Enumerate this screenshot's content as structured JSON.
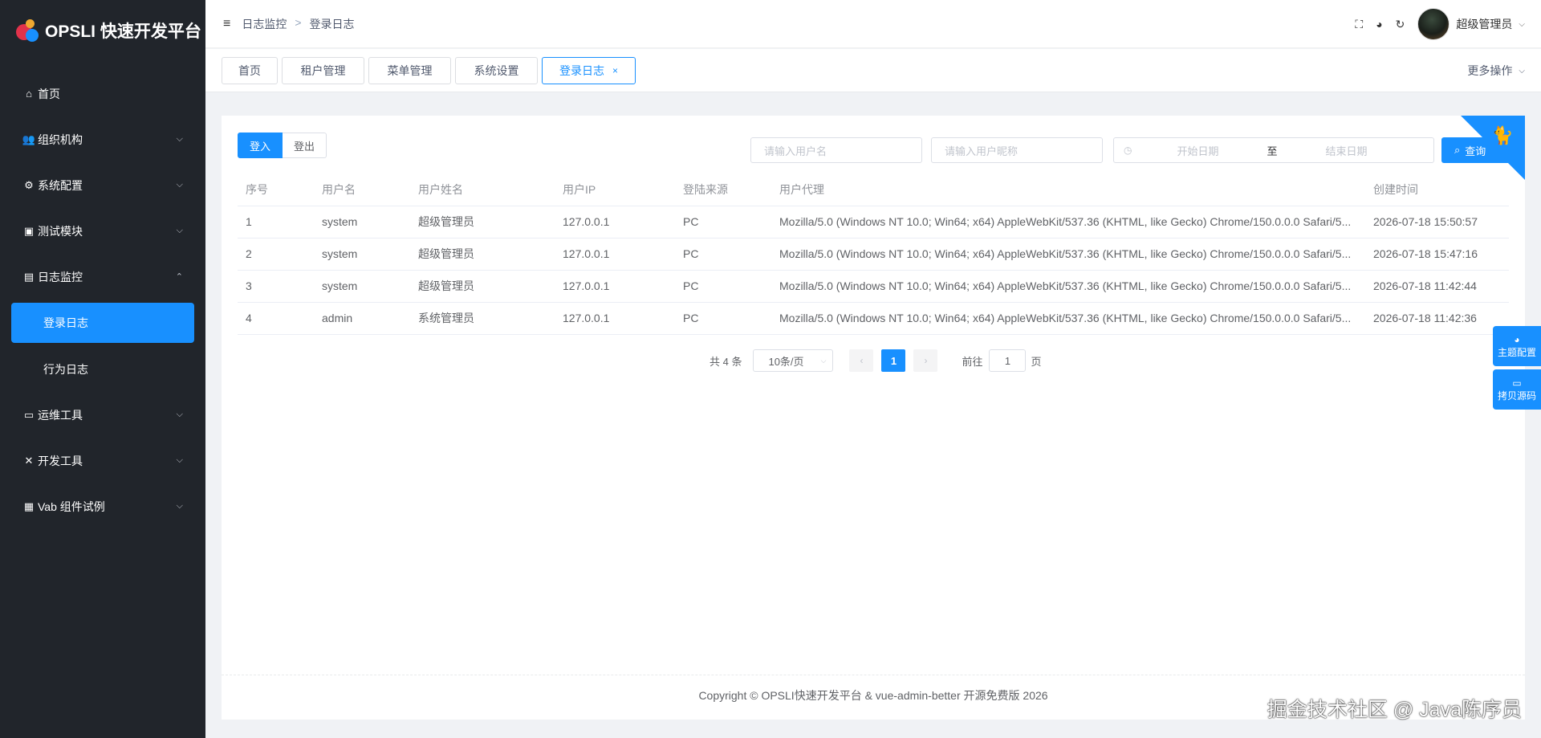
{
  "app": {
    "title": "OPSLI 快速开发平台"
  },
  "sidebar": {
    "items": [
      {
        "label": "首页",
        "icon": "home-icon",
        "glyph": "⌂"
      },
      {
        "label": "组织机构",
        "icon": "users-icon",
        "glyph": "👥"
      },
      {
        "label": "系统配置",
        "icon": "gear-icon",
        "glyph": "⚙"
      },
      {
        "label": "测试模块",
        "icon": "briefcase-icon",
        "glyph": "▣"
      },
      {
        "label": "日志监控",
        "icon": "file-icon",
        "glyph": "▤"
      },
      {
        "label": "运维工具",
        "icon": "monitor-icon",
        "glyph": "▭"
      },
      {
        "label": "开发工具",
        "icon": "tools-icon",
        "glyph": "✕"
      },
      {
        "label": "Vab 组件试例",
        "icon": "box-icon",
        "glyph": "▦"
      }
    ],
    "sub": {
      "login_log": "登录日志",
      "action_log": "行为日志"
    }
  },
  "navbar": {
    "breadcrumb": [
      "日志监控",
      "登录日志"
    ],
    "username": "超级管理员"
  },
  "tabs": [
    {
      "label": "首页"
    },
    {
      "label": "租户管理"
    },
    {
      "label": "菜单管理"
    },
    {
      "label": "系统设置"
    },
    {
      "label": "登录日志"
    }
  ],
  "more_ops": "更多操作",
  "filter": {
    "login_label": "登入",
    "logout_label": "登出",
    "username_placeholder": "请输入用户名",
    "nickname_placeholder": "请输入用户昵称",
    "start_date": "开始日期",
    "range_sep": "至",
    "end_date": "结束日期",
    "query_label": "查询"
  },
  "table": {
    "headers": [
      "序号",
      "用户名",
      "用户姓名",
      "用户IP",
      "登陆来源",
      "用户代理",
      "创建时间"
    ],
    "rows": [
      [
        "1",
        "system",
        "超级管理员",
        "127.0.0.1",
        "PC",
        "Mozilla/5.0 (Windows NT 10.0; Win64; x64) AppleWebKit/537.36 (KHTML, like Gecko) Chrome/150.0.0.0 Safari/5...",
        "2026-07-18 15:50:57"
      ],
      [
        "2",
        "system",
        "超级管理员",
        "127.0.0.1",
        "PC",
        "Mozilla/5.0 (Windows NT 10.0; Win64; x64) AppleWebKit/537.36 (KHTML, like Gecko) Chrome/150.0.0.0 Safari/5...",
        "2026-07-18 15:47:16"
      ],
      [
        "3",
        "system",
        "超级管理员",
        "127.0.0.1",
        "PC",
        "Mozilla/5.0 (Windows NT 10.0; Win64; x64) AppleWebKit/537.36 (KHTML, like Gecko) Chrome/150.0.0.0 Safari/5...",
        "2026-07-18 11:42:44"
      ],
      [
        "4",
        "admin",
        "系统管理员",
        "127.0.0.1",
        "PC",
        "Mozilla/5.0 (Windows NT 10.0; Win64; x64) AppleWebKit/537.36 (KHTML, like Gecko) Chrome/150.0.0.0 Safari/5...",
        "2026-07-18 11:42:36"
      ]
    ]
  },
  "pagination": {
    "total": "共 4 条",
    "page_size": "10条/页",
    "current": "1",
    "goto_label": "前往",
    "goto_value": "1",
    "page_suffix": "页"
  },
  "footer": "Copyright © OPSLI快速开发平台 & vue-admin-better 开源免费版 2026",
  "side_panel": {
    "theme": "主题配置",
    "copy": "拷贝源码"
  },
  "watermark": "掘金技术社区 @ Java陈序员",
  "colors": {
    "primary": "#1890ff",
    "sidebar": "#21252b"
  }
}
